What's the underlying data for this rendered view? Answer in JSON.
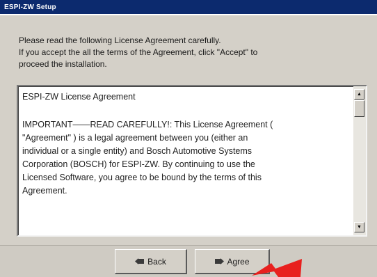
{
  "window": {
    "title": "ESPI-ZW Setup"
  },
  "intro": {
    "line1": "Please read the following License Agreement carefully.",
    "line2": "If you accept the all the terms of the Agreement, click \"Accept\" to",
    "line3": "proceed the installation."
  },
  "license": {
    "heading": "ESPI-ZW License Agreement",
    "body_lines": [
      "IMPORTANT——READ CAREFULLY!:  This License Agreement (",
      "\"Agreement\" ) is a legal agreement between you (either an",
      "individual or a single entity) and Bosch Automotive Systems",
      "Corporation (BOSCH) for ESPI-ZW. By continuing to use the",
      "Licensed Software, you agree to be bound by the terms of this",
      "Agreement."
    ]
  },
  "scrollbar": {
    "up_icon": "scroll-up-arrow",
    "down_icon": "scroll-down-arrow"
  },
  "buttons": {
    "back_label": "Back",
    "agree_label": "Agree",
    "back_icon": "back-arrow-icon",
    "agree_icon": "forward-arrow-icon"
  },
  "colors": {
    "titlebar": "#0c2a6e",
    "dialog_bg": "#d4d0c8",
    "pointer_arrow": "#e8201e"
  }
}
